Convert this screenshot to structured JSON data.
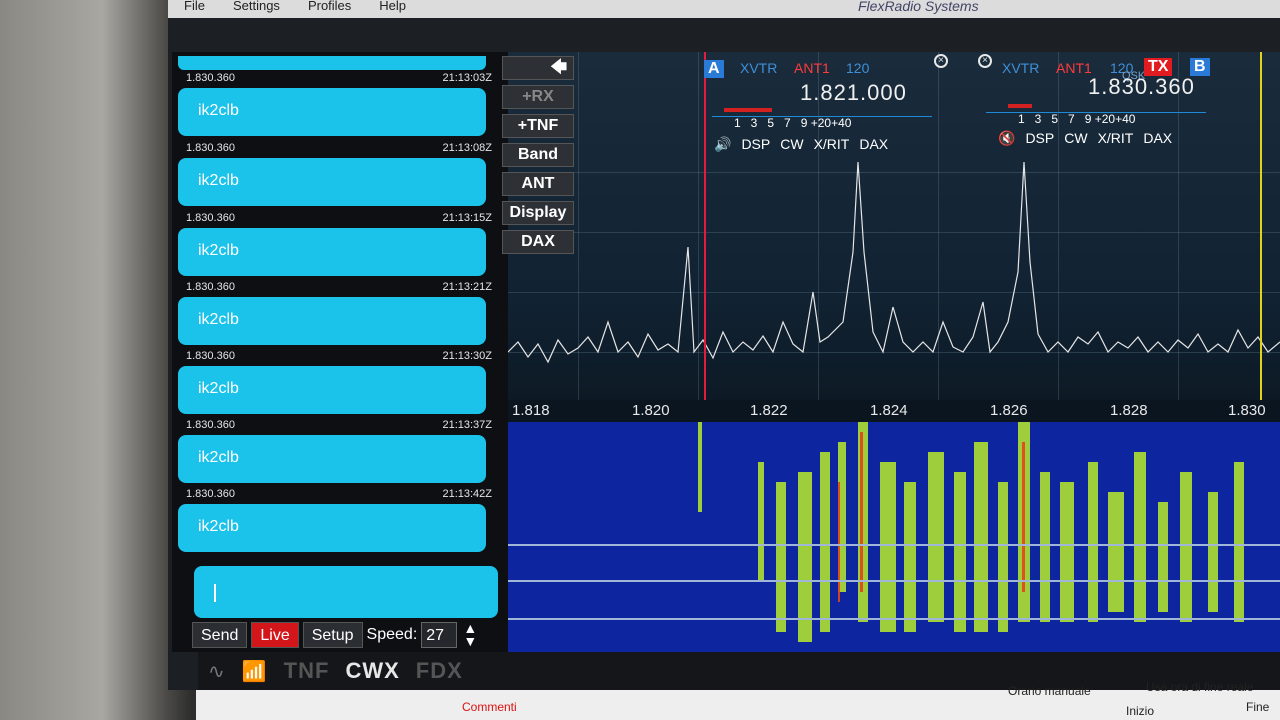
{
  "menu": {
    "items": [
      "File",
      "Settings",
      "Profiles",
      "Help"
    ],
    "brand": "FlexRadio Systems"
  },
  "cwx": {
    "messages": [
      {
        "freq": "1.830.360",
        "time": "21:13:03Z",
        "text": "ik2clb"
      },
      {
        "freq": "1.830.360",
        "time": "21:13:08Z",
        "text": "ik2clb"
      },
      {
        "freq": "1.830.360",
        "time": "21:13:15Z",
        "text": "ik2clb"
      },
      {
        "freq": "1.830.360",
        "time": "21:13:21Z",
        "text": "ik2clb"
      },
      {
        "freq": "1.830.360",
        "time": "21:13:30Z",
        "text": "ik2clb"
      },
      {
        "freq": "1.830.360",
        "time": "21:13:37Z",
        "text": "ik2clb"
      },
      {
        "freq": "1.830.360",
        "time": "21:13:42Z",
        "text": "ik2clb"
      }
    ],
    "toolbar": {
      "send": "Send",
      "live": "Live",
      "setup": "Setup",
      "speed_label": "Speed:",
      "speed_value": "27"
    }
  },
  "panel_buttons": [
    "+RX",
    "+TNF",
    "Band",
    "ANT",
    "Display",
    "DAX"
  ],
  "bottom_bar": {
    "tnf": "TNF",
    "cwx": "CWX",
    "fdx": "FDX"
  },
  "slice_a": {
    "letter": "A",
    "xvtr": "XVTR",
    "ant": "ANT1",
    "filter": "120",
    "freq": "1.821.000",
    "scale": "1   3   5   7   9 +20+40",
    "footer": [
      "DSP",
      "CW",
      "X/RIT",
      "DAX"
    ]
  },
  "slice_b": {
    "letter": "B",
    "xvtr": "XVTR",
    "ant": "ANT1",
    "filter": "120",
    "freq": "1.830.360",
    "tx": "TX",
    "qsk": "QSK",
    "scale": "1   3   5   7   9 +20+40",
    "footer": [
      "DSP",
      "CW",
      "X/RIT",
      "DAX"
    ]
  },
  "freq_scale": [
    "1.818",
    "1.820",
    "1.822",
    "1.824",
    "1.826",
    "1.828",
    "1.830"
  ],
  "taskbar": {
    "orario": "Orario manuale",
    "usa": "Usa ora di fine reale",
    "commenti": "Commenti",
    "inizio": "Inizio",
    "fine": "Fine"
  },
  "colors": {
    "message_bg": "#1bc3ea",
    "live": "#d2161a",
    "tx": "#e11b1f"
  }
}
